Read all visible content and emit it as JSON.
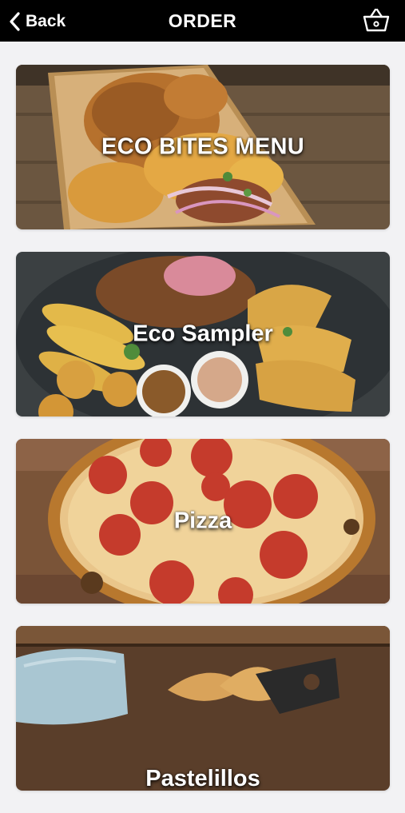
{
  "header": {
    "back_label": "Back",
    "title": "ORDER",
    "icons": {
      "back": "chevron-left-icon",
      "cart": "basket-icon"
    }
  },
  "menu": {
    "items": [
      {
        "label": "ECO BITES MENU"
      },
      {
        "label": "Eco Sampler"
      },
      {
        "label": "Pizza"
      },
      {
        "label": "Pastelillos"
      }
    ]
  }
}
